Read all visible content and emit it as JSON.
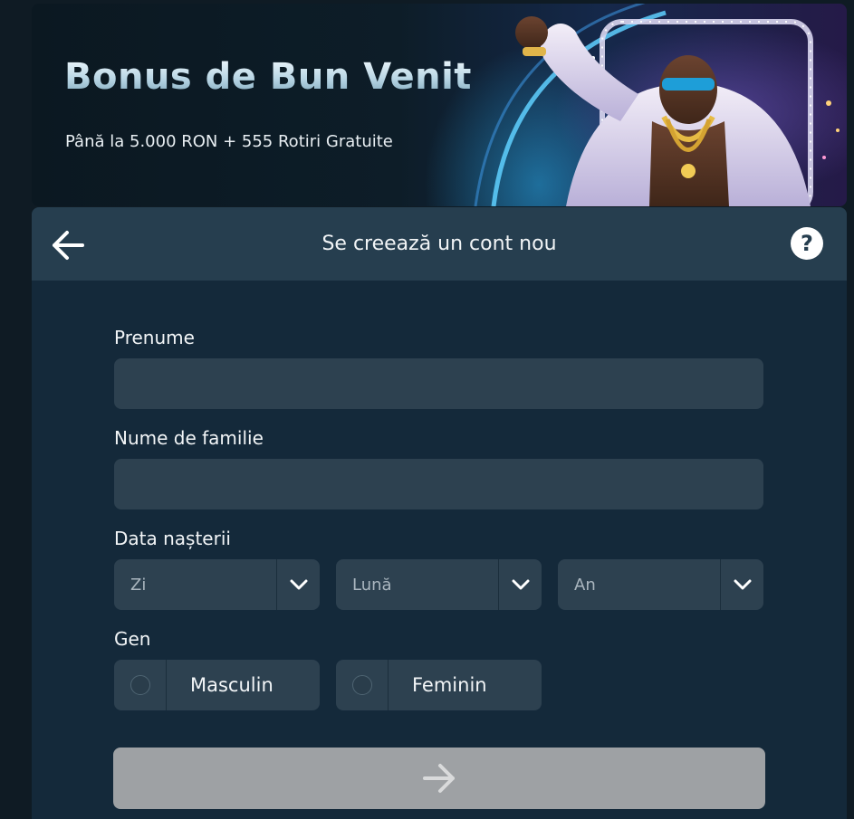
{
  "banner": {
    "title": "Bonus de Bun Venit",
    "subtitle": "Până la 5.000 RON + 555 Rotiri Gratuite"
  },
  "header": {
    "title": "Se creează un cont nou",
    "back_icon": "arrow-left-icon",
    "help_icon": "question-mark-icon"
  },
  "form": {
    "first_name": {
      "label": "Prenume",
      "value": ""
    },
    "last_name": {
      "label": "Nume de familie",
      "value": ""
    },
    "birth_date": {
      "label": "Data nașterii",
      "day": "Zi",
      "month": "Lună",
      "year": "An"
    },
    "gender": {
      "label": "Gen",
      "options": [
        "Masculin",
        "Feminin"
      ]
    },
    "submit_icon": "arrow-right-icon"
  },
  "colors": {
    "page_bg": "#0f1b24",
    "card_bg": "#14293a",
    "header_bg": "#263e4f",
    "field_bg": "#2d4150",
    "submit_disabled": "#9ea1a4"
  }
}
